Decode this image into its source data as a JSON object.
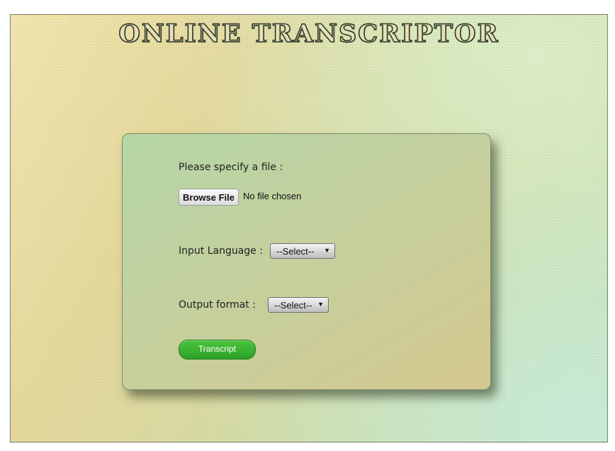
{
  "header": {
    "title": "ONLINE TRANSCRIPTOR"
  },
  "form": {
    "file_label": "Please specify a file :",
    "browse_label": "Browse File",
    "file_status": "No file chosen",
    "input_language_label": "Input Language :",
    "input_language_value": "--Select--",
    "output_format_label": "Output format :",
    "output_format_value": "--Select--",
    "submit_label": "Transcript"
  },
  "colors": {
    "submit_button": "#34a82b",
    "panel_start": "#b5d6a6",
    "panel_end": "#d4c88e"
  },
  "icons": {
    "select_arrow": "dropdown-arrow-icon"
  }
}
